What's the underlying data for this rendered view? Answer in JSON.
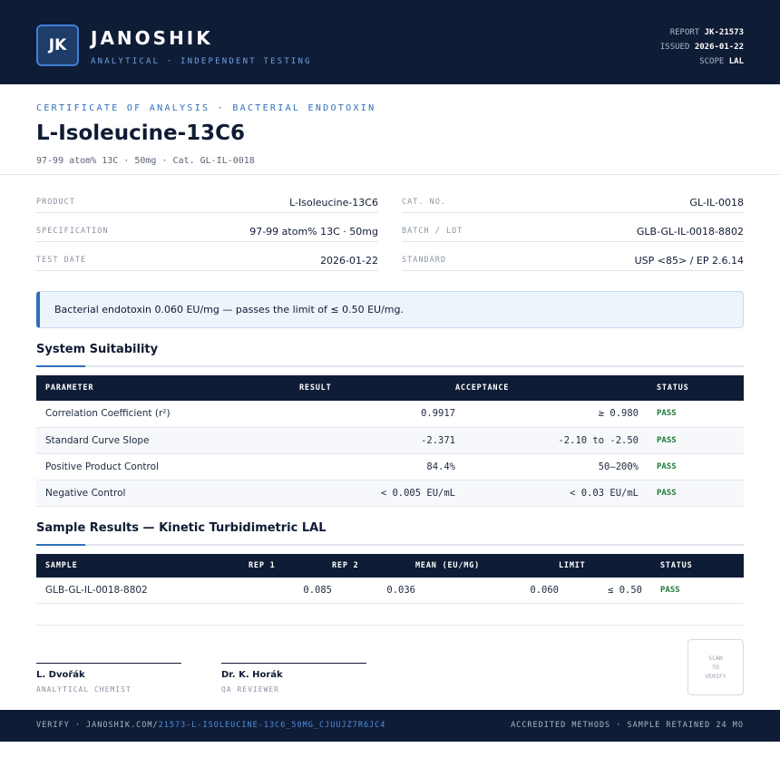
{
  "header": {
    "logo_text": "JK",
    "brand_name": "JANOSHIK",
    "brand_tagline": "ANALYTICAL · INDEPENDENT TESTING",
    "report_label": "REPORT",
    "report_value": "JK-21573",
    "issued_label": "ISSUED",
    "issued_value": "2026-01-22",
    "scope_label": "SCOPE",
    "scope_value": "LAL"
  },
  "document": {
    "eyebrow": "CERTIFICATE OF ANALYSIS · BACTERIAL ENDOTOXIN",
    "title": "L-Isoleucine-13C6",
    "subtitle": "97-99 atom% 13C · 50mg  ·  Cat. GL-IL-0018"
  },
  "info": {
    "left": [
      {
        "label": "PRODUCT",
        "value": "L-Isoleucine-13C6"
      },
      {
        "label": "SPECIFICATION",
        "value": "97-99 atom% 13C · 50mg"
      },
      {
        "label": "TEST DATE",
        "value": "2026-01-22"
      }
    ],
    "right": [
      {
        "label": "CAT. NO.",
        "value": "GL-IL-0018"
      },
      {
        "label": "BATCH / LOT",
        "value": "GLB-GL-IL-0018-8802"
      },
      {
        "label": "STANDARD",
        "value": "USP <85> / EP 2.6.14"
      }
    ]
  },
  "banner": {
    "text": "Bacterial endotoxin 0.060 EU/mg — passes the limit of ≤ 0.50 EU/mg."
  },
  "suitability": {
    "title": "System Suitability",
    "headers": [
      "PARAMETER",
      "RESULT",
      "ACCEPTANCE",
      "STATUS"
    ],
    "rows": [
      {
        "parameter": "Correlation Coefficient (r²)",
        "result": "0.9917",
        "acceptance": "≥ 0.980",
        "status": "PASS"
      },
      {
        "parameter": "Standard Curve Slope",
        "result": "-2.371",
        "acceptance": "-2.10 to -2.50",
        "status": "PASS"
      },
      {
        "parameter": "Positive Product Control",
        "result": "84.4%",
        "acceptance": "50–200%",
        "status": "PASS"
      },
      {
        "parameter": "Negative Control",
        "result": "< 0.005 EU/mL",
        "acceptance": "< 0.03 EU/mL",
        "status": "PASS"
      }
    ]
  },
  "samples": {
    "title": "Sample Results — Kinetic Turbidimetric LAL",
    "headers": [
      "SAMPLE",
      "REP 1",
      "REP 2",
      "MEAN (EU/MG)",
      "LIMIT",
      "STATUS"
    ],
    "rows": [
      {
        "sample": "GLB-GL-IL-0018-8802",
        "rep1": "0.085",
        "rep2": "0.036",
        "mean": "0.060",
        "limit": "≤ 0.50",
        "status": "PASS"
      }
    ]
  },
  "signatures": [
    {
      "name": "L. Dvořák",
      "role": "ANALYTICAL CHEMIST"
    },
    {
      "name": "Dr. K. Horák",
      "role": "QA REVIEWER"
    }
  ],
  "qr": {
    "line1": "SCAN",
    "line2": "TO",
    "line3": "VERIFY"
  },
  "footer": {
    "verify_prefix": "VERIFY · JANOSHIK.COM/",
    "verify_link": "21573-L-ISOLEUCINE-13C6_50MG_CJUUJZ7R6JC4",
    "right": "ACCREDITED METHODS · SAMPLE RETAINED 24 MO"
  },
  "colors": {
    "navy": "#0f1c35",
    "accent_blue": "#2f6fb8",
    "pass_green": "#1f7a3a",
    "banner_bg": "#eef4fc"
  }
}
